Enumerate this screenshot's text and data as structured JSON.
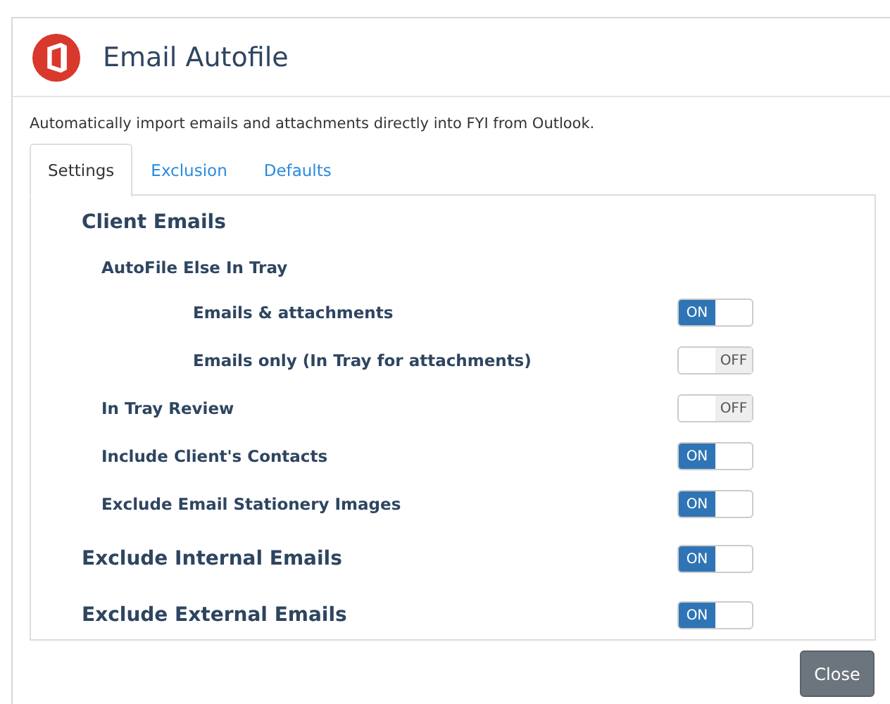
{
  "dialog": {
    "title": "Email Autofile",
    "description": "Automatically import emails and attachments directly into FYI from Outlook."
  },
  "tabs": [
    {
      "label": "Settings",
      "selected": true
    },
    {
      "label": "Exclusion",
      "selected": false
    },
    {
      "label": "Defaults",
      "selected": false
    }
  ],
  "rows": [
    {
      "kind": "section",
      "label": "Client Emails"
    },
    {
      "kind": "group",
      "label": "AutoFile Else In Tray"
    },
    {
      "kind": "option",
      "label": "Emails & attachments",
      "toggle": {
        "on": true,
        "text": "ON"
      }
    },
    {
      "kind": "option",
      "label": "Emails only (In Tray for attachments)",
      "toggle": {
        "on": false,
        "text": "OFF"
      }
    },
    {
      "kind": "setting",
      "label": "In Tray Review",
      "toggle": {
        "on": false,
        "text": "OFF"
      }
    },
    {
      "kind": "setting",
      "label": "Include Client's Contacts",
      "toggle": {
        "on": true,
        "text": "ON"
      }
    },
    {
      "kind": "setting",
      "label": "Exclude Email Stationery Images",
      "toggle": {
        "on": true,
        "text": "ON"
      }
    },
    {
      "kind": "major",
      "label": "Exclude Internal Emails",
      "toggle": {
        "on": true,
        "text": "ON"
      }
    },
    {
      "kind": "major",
      "label": "Exclude External Emails",
      "toggle": {
        "on": true,
        "text": "ON"
      }
    }
  ],
  "buttons": [
    {
      "label": "Close"
    }
  ]
}
